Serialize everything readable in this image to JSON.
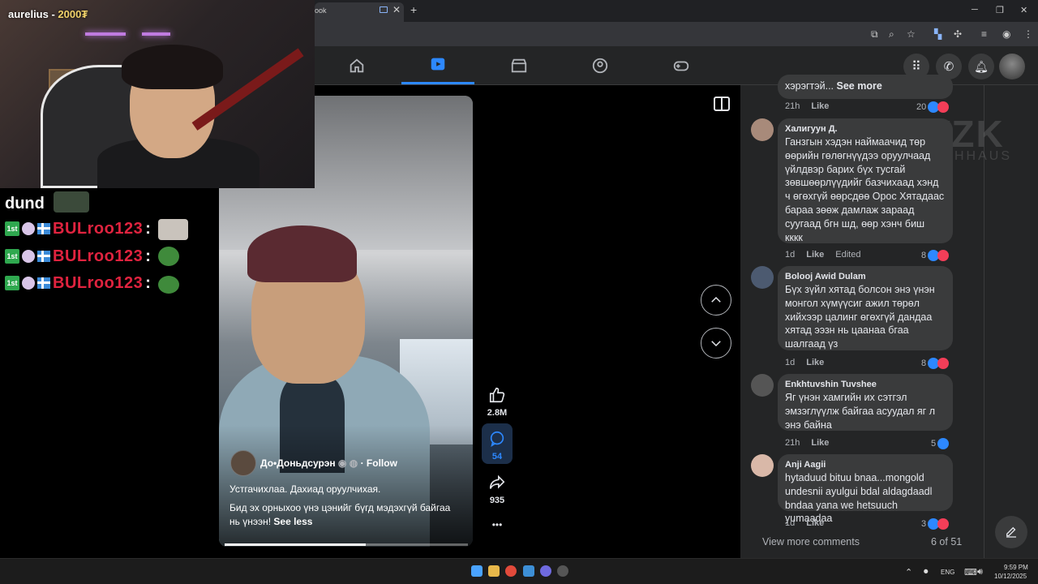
{
  "browser": {
    "tab_title": "ook",
    "window_controls": {
      "minimize": "─",
      "maximize": "❐",
      "close": "✕"
    },
    "new_tab": "+",
    "tab_close": "✕"
  },
  "stream": {
    "streamer_name": "aurelius - ",
    "streamer_points": "2000₮",
    "chat_top_user": "dund",
    "chat_messages": [
      {
        "badge": "1st",
        "username": "BULroo123",
        "separator": ":"
      },
      {
        "badge": "1st",
        "username": "BULroo123",
        "separator": ":"
      },
      {
        "badge": "1st",
        "username": "BULroo123",
        "separator": ":"
      }
    ]
  },
  "reel": {
    "author": "До•Доньдсурэн",
    "follow_label": "Follow",
    "separator": "·",
    "caption_line1": "Устгачихлаа. Дахиад оруулчихая.",
    "caption_line2": "Бид эх орныхоо үнэ цэнийг бүгд мэдэхгүй байгаа",
    "caption_line3": "нь үнээн!",
    "see_less": "See less",
    "likes": "2.8M",
    "comments": "54",
    "shares": "935",
    "more": "•••",
    "progress": 0.58
  },
  "comments": [
    {
      "name": "",
      "text": "хэрэгтэй...",
      "see_more": "See more",
      "time": "21h",
      "like": "Like",
      "edited": "",
      "reactions": "20"
    },
    {
      "name": "Халигуун Д.",
      "text": "Ганзгын хэдэн наймаачид төр\nөөрийн гөлөгнүүдээ оруулчаад\nүйлдвэр барих бүх тусгай\nзөвшөөрлүүдийг бaзчихаад хэнд\nч өгөхгүй өөрсдөө Орос Хятадаас\nбараа зөөж дамлаж зараад\nсуугаад бгн шд, өөр хэнч биш\nкккк",
      "time": "1d",
      "like": "Like",
      "edited": "Edited",
      "reactions": "8"
    },
    {
      "name": "Bolooj Awid Dulam",
      "text": "Бүх зүйл хятад болсон энэ үнэн\nмонгол хүмүүсиг ажил төрөл\nхийхээр цалинг өгөхгүй дандаа\nхятад ээзн нь цаанаа бгаа\nшалгаад үз",
      "time": "1d",
      "like": "Like",
      "edited": "",
      "reactions": "8"
    },
    {
      "name": "Enkhtuvshin Tuvshee",
      "text": "Яг үнэн хамгийн их сэтгэл\nэмзэглүүлж байгаа асуудал яг л\nэнэ байна",
      "time": "21h",
      "like": "Like",
      "edited": "",
      "reactions": "5"
    },
    {
      "name": "Anji Aagii",
      "text": "hytaduud bituu bnaa...mongold\nundesnii ayulgui bdal aldagdaadl\nbndaa yana we hetsuuch yumaadaa",
      "time": "1d",
      "like": "Like",
      "edited": "",
      "reactions": "3"
    }
  ],
  "comments_footer": {
    "view_more": "View more comments",
    "count": "6 of 51"
  },
  "watermark": {
    "main": "WZK",
    "sub": "TECHHAUS"
  },
  "taskbar": {
    "lang": "ENG",
    "time": "9:59 PM",
    "date": "10/12/2025"
  },
  "colors": {
    "accent": "#2d88ff",
    "love": "#f33e58",
    "panel": "#242526",
    "bubble": "#3a3b3c",
    "chat_name": "#e0233f"
  }
}
